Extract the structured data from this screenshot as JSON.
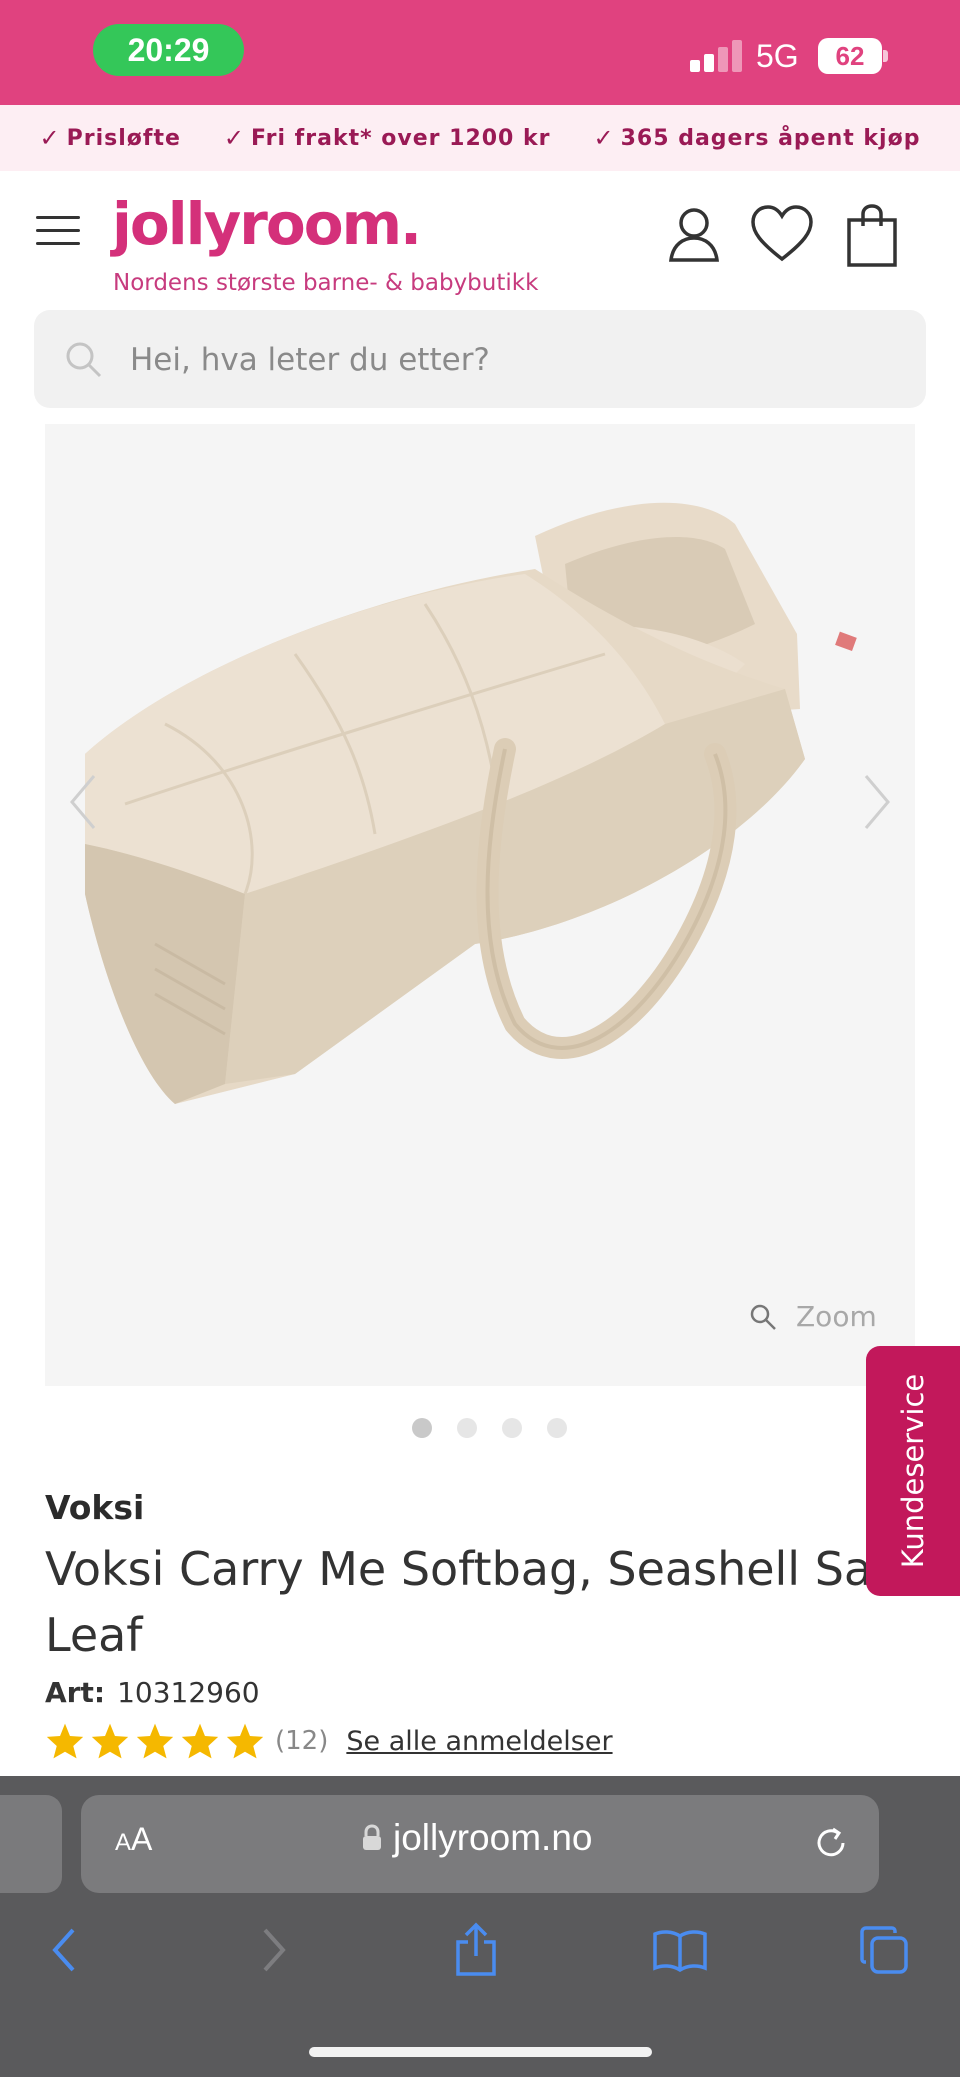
{
  "status_bar": {
    "time": "20:29",
    "network": "5G",
    "battery": "62"
  },
  "usp": [
    {
      "text": "Prisløfte"
    },
    {
      "text": "Fri frakt* over 1200 kr"
    },
    {
      "text": "365 dagers åpent kjøp"
    }
  ],
  "header": {
    "logo": "jollyroom.",
    "tagline": "Nordens største barne- & babybutikk",
    "icons": [
      "menu-icon",
      "account-icon",
      "wishlist-heart-icon",
      "shopping-bag-icon"
    ]
  },
  "search": {
    "placeholder": "Hei, hva leter du etter?"
  },
  "gallery": {
    "zoom_label": "Zoom",
    "image_count": 4,
    "active_index": 0
  },
  "product": {
    "brand": "Voksi",
    "title_line1": "Voksi Carry Me Softbag, Seashell Sand",
    "title_line2": "Leaf",
    "art_label": "Art:",
    "art_number": "10312960",
    "rating": 5,
    "review_count": "(12)",
    "reviews_link": "Se alle anmeldelser"
  },
  "kundeservice": "Kundeservice",
  "safari": {
    "aa_small": "A",
    "aa_big": "A",
    "domain": "jollyroom.no"
  },
  "colors": {
    "brand_pink": "#e0427f",
    "logo_pink": "#d4307a",
    "star": "#f5b800",
    "safari_blue": "#4a8cf0"
  }
}
